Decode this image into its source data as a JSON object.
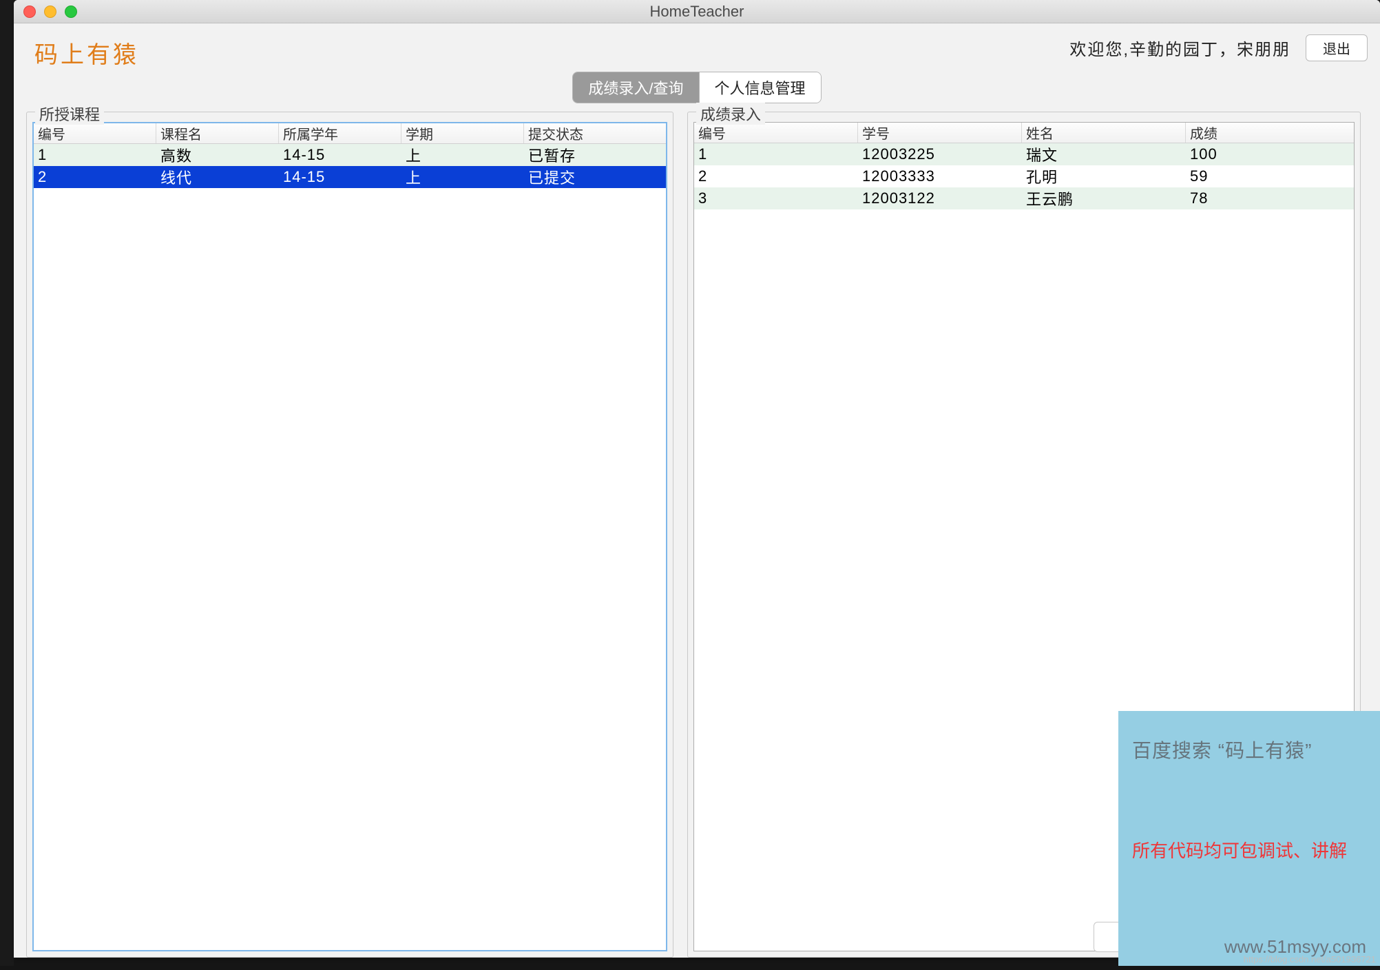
{
  "window": {
    "title": "HomeTeacher"
  },
  "logo": "码上有猿",
  "header": {
    "greeting": "欢迎您,辛勤的园丁，宋朋朋",
    "logout": "退出"
  },
  "tabs": {
    "t1": "成绩录入/查询",
    "t2": "个人信息管理"
  },
  "left": {
    "title": "所授课程",
    "cols": {
      "c1": "编号",
      "c2": "课程名",
      "c3": "所属学年",
      "c4": "学期",
      "c5": "提交状态"
    },
    "rows": [
      {
        "c1": "1",
        "c2": "高数",
        "c3": "14-15",
        "c4": "上",
        "c5": "已暂存",
        "selected": false
      },
      {
        "c1": "2",
        "c2": "线代",
        "c3": "14-15",
        "c4": "上",
        "c5": "已提交",
        "selected": true
      }
    ]
  },
  "right": {
    "title": "成绩录入",
    "cols": {
      "c1": "编号",
      "c2": "学号",
      "c3": "姓名",
      "c4": "成绩"
    },
    "rows": [
      {
        "c1": "1",
        "c2": "12003225",
        "c3": "瑞文",
        "c4": "100"
      },
      {
        "c1": "2",
        "c2": "12003333",
        "c3": "孔明",
        "c4": "59"
      },
      {
        "c1": "3",
        "c2": "12003122",
        "c3": "王云鹏",
        "c4": "78"
      }
    ]
  },
  "banner": {
    "l1": "百度搜索 “码上有猿”",
    "l2": "所有代码均可包调试、讲解",
    "l3": "www.51msyy.com"
  },
  "watermark": "https://blog.csdn.net/a501936721"
}
